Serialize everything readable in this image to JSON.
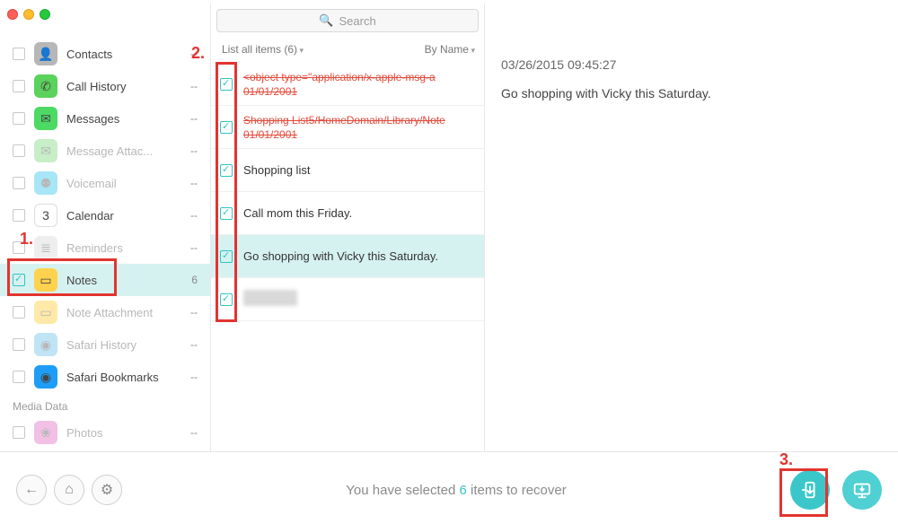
{
  "search": {
    "placeholder": "Search"
  },
  "sidebar": {
    "items": [
      {
        "label": "Contacts",
        "count": "--",
        "dim": false,
        "ic": "#b7b7b7",
        "glyph": "👤"
      },
      {
        "label": "Call History",
        "count": "--",
        "dim": false,
        "ic": "#5bd25b",
        "glyph": "✆"
      },
      {
        "label": "Messages",
        "count": "--",
        "dim": false,
        "ic": "#4cd964",
        "glyph": "✉"
      },
      {
        "label": "Message Attac...",
        "count": "--",
        "dim": true,
        "ic": "#c8eec8",
        "glyph": "✉"
      },
      {
        "label": "Voicemail",
        "count": "--",
        "dim": true,
        "ic": "#a7e6f7",
        "glyph": "⚉"
      },
      {
        "label": "Calendar",
        "count": "--",
        "dim": false,
        "ic": "#ffffff",
        "glyph": "3",
        "border": true
      },
      {
        "label": "Reminders",
        "count": "--",
        "dim": true,
        "ic": "#eeeeee",
        "glyph": "≣"
      },
      {
        "label": "Notes",
        "count": "6",
        "dim": false,
        "ic": "#ffd24d",
        "glyph": "▭",
        "active": true
      },
      {
        "label": "Note Attachment",
        "count": "--",
        "dim": true,
        "ic": "#ffe9a8",
        "glyph": "▭"
      },
      {
        "label": "Safari History",
        "count": "--",
        "dim": true,
        "ic": "#bfe5f4",
        "glyph": "◉"
      },
      {
        "label": "Safari Bookmarks",
        "count": "--",
        "dim": false,
        "ic": "#1e9df7",
        "glyph": "◉"
      }
    ],
    "section2_label": "Media Data",
    "section2_items": [
      {
        "label": "Photos",
        "count": "--",
        "dim": true,
        "ic": "#f2c0e4",
        "glyph": "❀"
      }
    ]
  },
  "mid": {
    "filter_label": "List all items (6)",
    "sort_label": "By Name",
    "items": [
      {
        "l1": "<object type=\"application/x-apple-msg-a",
        "l2": "01/01/2001",
        "deleted": true
      },
      {
        "l1": "Shopping List5/HomeDomain/Library/Note",
        "l2": "01/01/2001",
        "deleted": true
      },
      {
        "l1": "Shopping list"
      },
      {
        "l1": "Call mom this Friday."
      },
      {
        "l1": "Go shopping with Vicky this Saturday.",
        "sel": true
      },
      {
        "blurred": true
      }
    ]
  },
  "detail": {
    "timestamp": "03/26/2015 09:45:27",
    "body": "Go shopping with Vicky this Saturday."
  },
  "footer": {
    "status_pre": "You have selected ",
    "status_num": "6",
    "status_post": " items to recover"
  },
  "callouts": {
    "n1": "1.",
    "n2": "2.",
    "n3": "3."
  }
}
